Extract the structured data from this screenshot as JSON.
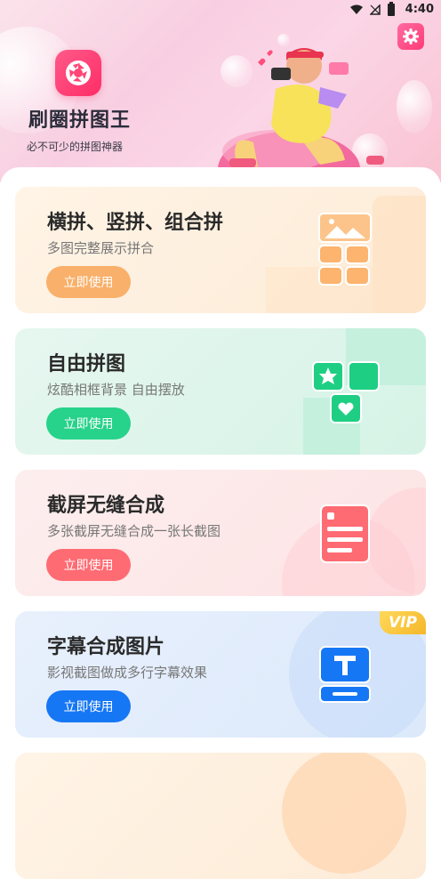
{
  "status_bar": {
    "time": "4:40"
  },
  "app": {
    "title": "刷圈拼图王",
    "subtitle": "必不可少的拼图神器"
  },
  "colors": {
    "orange": "#f9b06a",
    "green": "#27d28a",
    "red": "#ff6b73",
    "blue": "#1677f5",
    "vip": "#f7c43a"
  },
  "cards": [
    {
      "title": "横拼、竖拼、组合拼",
      "subtitle": "多图完整展示拼合",
      "button": "立即使用",
      "icon": "grid-layout-icon"
    },
    {
      "title": "自由拼图",
      "subtitle": "炫酷相框背景 自由摆放",
      "button": "立即使用",
      "icon": "free-puzzle-icon"
    },
    {
      "title": "截屏无缝合成",
      "subtitle": "多张截屏无缝合成一张长截图",
      "button": "立即使用",
      "icon": "screenshot-merge-icon"
    },
    {
      "title": "字幕合成图片",
      "subtitle": "影视截图做成多行字幕效果",
      "button": "立即使用",
      "icon": "subtitle-icon",
      "badge": "VIP"
    }
  ],
  "partial_card": {
    "title": ""
  }
}
